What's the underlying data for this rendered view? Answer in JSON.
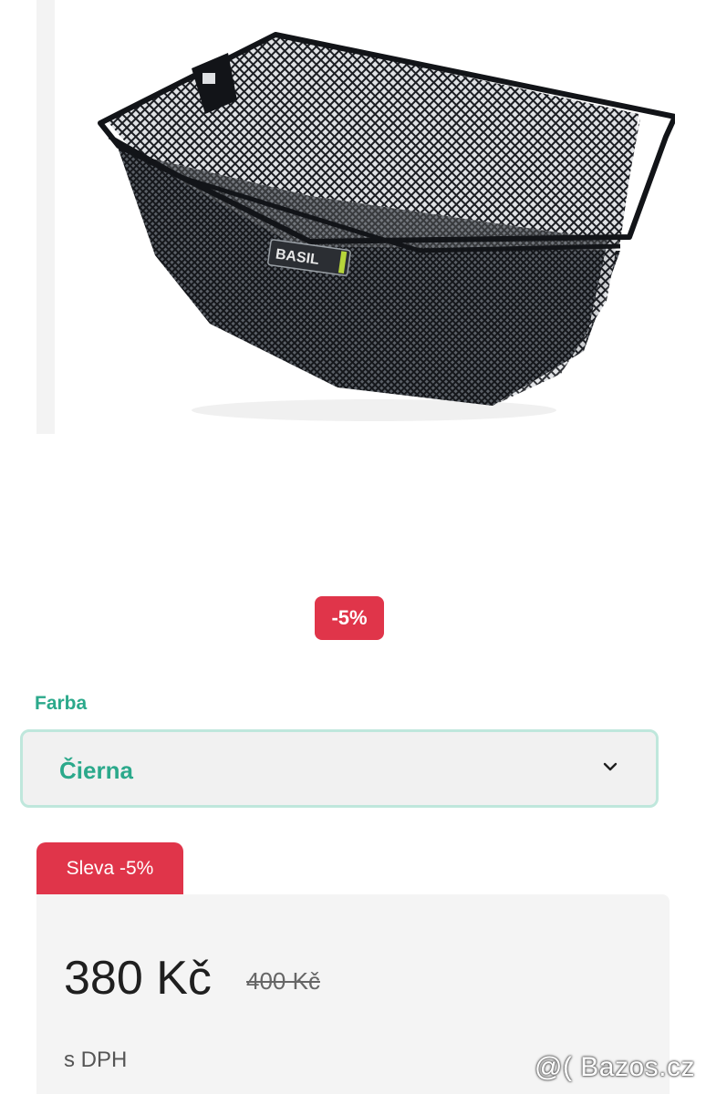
{
  "product": {
    "image_alt": "Basil bicycle basket",
    "image_brand_text": "BASIL"
  },
  "discount_badge": "-5%",
  "variant": {
    "label": "Farba",
    "selected": "Čierna"
  },
  "price": {
    "sale_tab": "Sleva -5%",
    "current": "380 Kč",
    "old": "400 Kč",
    "tax_note": "s DPH"
  },
  "watermark": "@( Bazos.cz",
  "colors": {
    "accent_green": "#2ba98b",
    "sale_red": "#e0354a",
    "panel_grey": "#f4f4f4"
  }
}
